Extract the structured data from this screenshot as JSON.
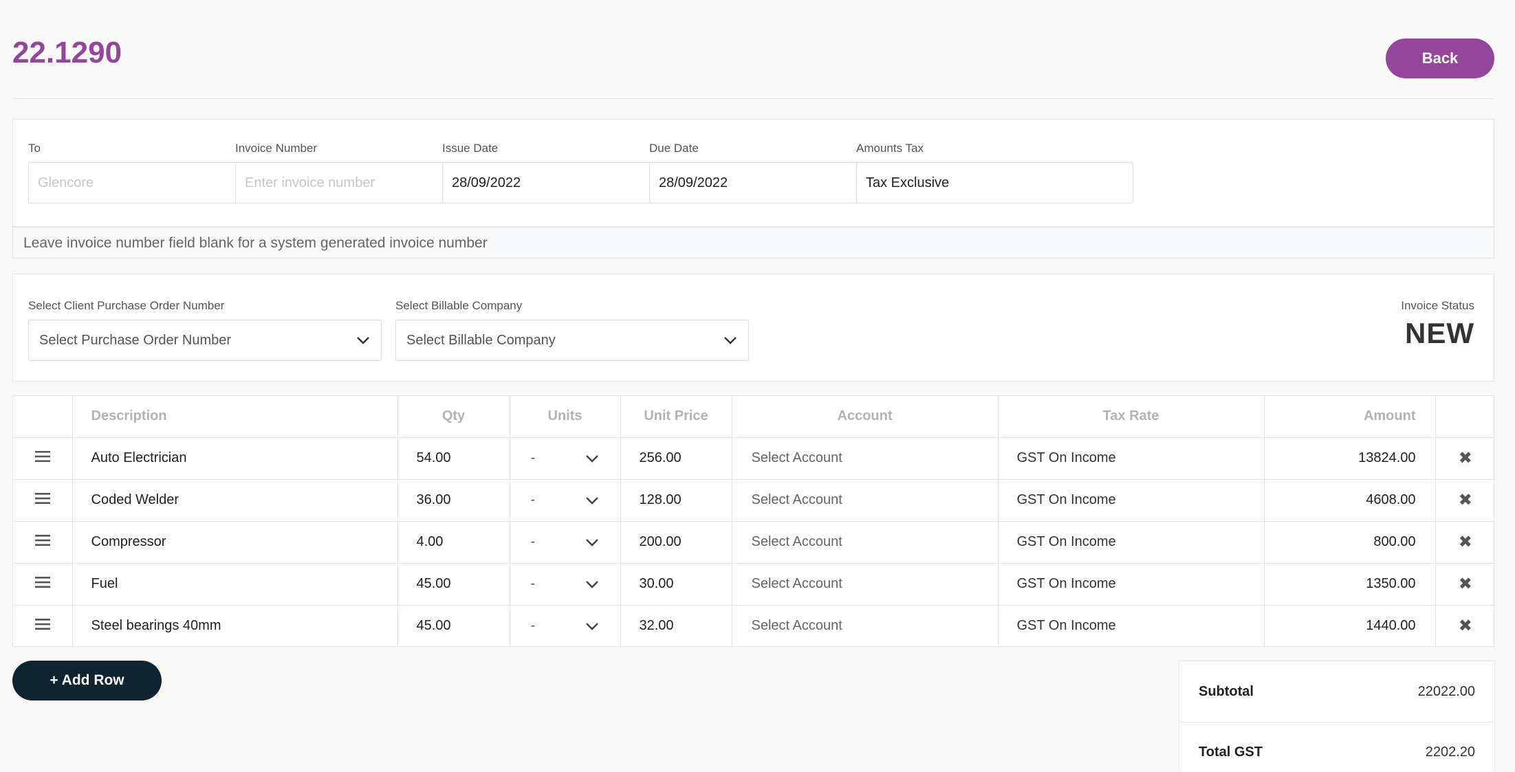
{
  "header": {
    "title": "22.1290",
    "back_label": "Back"
  },
  "fields": [
    {
      "label": "To",
      "value": "",
      "placeholder": "Glencore"
    },
    {
      "label": "Invoice Number",
      "value": "",
      "placeholder": "Enter invoice number"
    },
    {
      "label": "Issue Date",
      "value": "28/09/2022",
      "placeholder": ""
    },
    {
      "label": "Due Date",
      "value": "28/09/2022",
      "placeholder": ""
    },
    {
      "label": "Amounts Tax",
      "value": "Tax Exclusive",
      "placeholder": ""
    }
  ],
  "note": "Leave invoice number field blank for a system generated invoice number",
  "selects": {
    "po": {
      "label": "Select Client Purchase Order Number",
      "value": "Select Purchase Order Number"
    },
    "company": {
      "label": "Select Billable Company",
      "value": "Select Billable Company"
    }
  },
  "status": {
    "label": "Invoice Status",
    "value": "NEW"
  },
  "table": {
    "headers": [
      "Description",
      "Qty",
      "Units",
      "Unit Price",
      "Account",
      "Tax Rate",
      "Amount"
    ],
    "rows": [
      {
        "description": "Auto Electrician",
        "qty": "54.00",
        "units": "-",
        "unit_price": "256.00",
        "account": "Select Account",
        "tax_rate": "GST On Income",
        "amount": "13824.00"
      },
      {
        "description": "Coded Welder",
        "qty": "36.00",
        "units": "-",
        "unit_price": "128.00",
        "account": "Select Account",
        "tax_rate": "GST On Income",
        "amount": "4608.00"
      },
      {
        "description": "Compressor",
        "qty": "4.00",
        "units": "-",
        "unit_price": "200.00",
        "account": "Select Account",
        "tax_rate": "GST On Income",
        "amount": "800.00"
      },
      {
        "description": "Fuel",
        "qty": "45.00",
        "units": "-",
        "unit_price": "30.00",
        "account": "Select Account",
        "tax_rate": "GST On Income",
        "amount": "1350.00"
      },
      {
        "description": "Steel bearings 40mm",
        "qty": "45.00",
        "units": "-",
        "unit_price": "32.00",
        "account": "Select Account",
        "tax_rate": "GST On Income",
        "amount": "1440.00"
      }
    ]
  },
  "actions": {
    "add_row_label": "+ Add Row"
  },
  "totals": {
    "subtotal_label": "Subtotal",
    "subtotal_value": "22022.00",
    "gst_label": "Total GST",
    "gst_value": "2202.20"
  },
  "icons": {
    "row_handle": "drag-handle-icon",
    "row_delete": "delete-icon",
    "dropdown": "chevron-down-icon"
  },
  "colors": {
    "accent": "#94479a",
    "add_button": "#0f2330"
  }
}
